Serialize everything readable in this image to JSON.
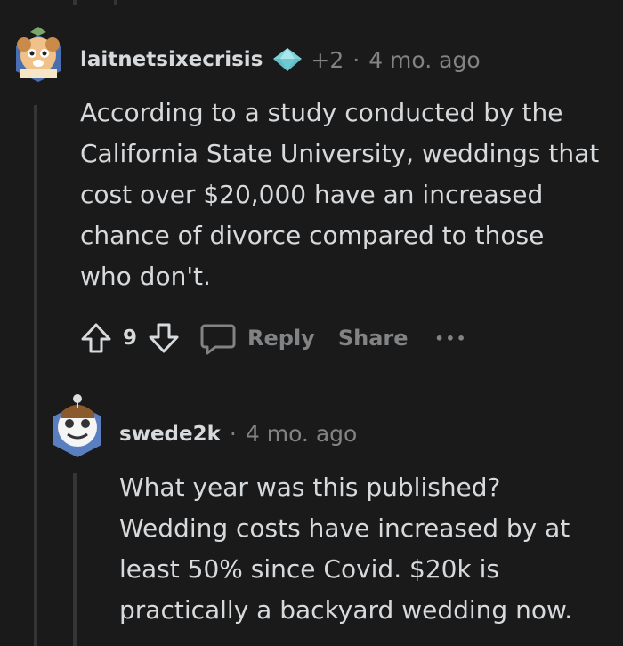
{
  "comments": [
    {
      "username": "laitnetsixecrisis",
      "karma_change": "+2",
      "separator": "·",
      "age": "4 mo. ago",
      "body_lines": [
        "According to a study conducted by the",
        "California State University, weddings that",
        "cost over $20,000 have an increased",
        "chance of divorce compared to those",
        "who don't."
      ],
      "votes": "9",
      "reply_label": "Reply",
      "share_label": "Share",
      "more_label": "•••"
    },
    {
      "username": "swede2k",
      "separator": "·",
      "age": "4 mo. ago",
      "body_lines": [
        "What year was this published?",
        "Wedding costs have increased by at",
        "least 50% since Covid. $20k is",
        "practically a backyard wedding now."
      ]
    }
  ],
  "colors": {
    "background": "#1a1a1b",
    "text": "#d7dadc",
    "muted": "#818384",
    "thread_line": "#343536"
  }
}
